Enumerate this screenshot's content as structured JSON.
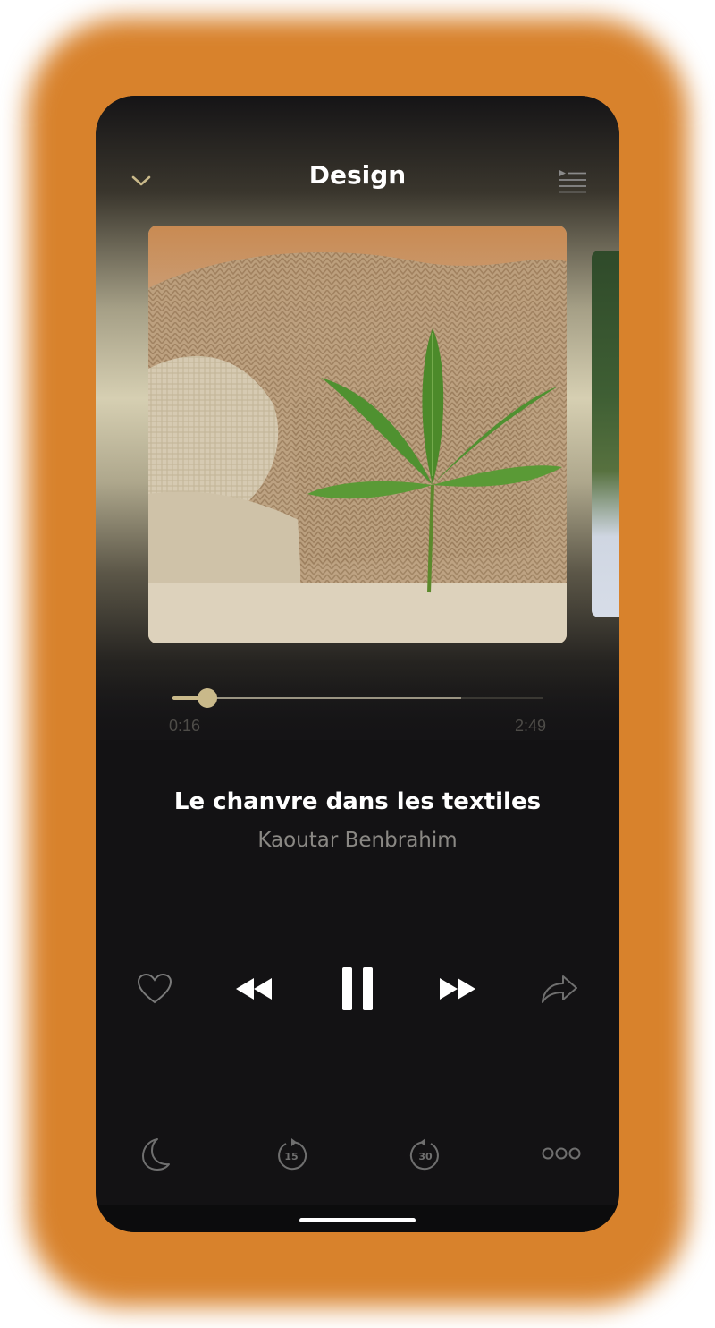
{
  "header": {
    "title": "Design",
    "collapse_icon": "chevron-down-icon",
    "queue_icon": "playlist-icon"
  },
  "artwork": {
    "current": "hemp-leaf-on-knitted-textile",
    "next": "trees-peek"
  },
  "playback": {
    "elapsed": "0:16",
    "duration": "2:49",
    "progress_fraction": 0.095,
    "buffered_fraction": 0.78
  },
  "track": {
    "title": "Le chanvre dans les textiles",
    "artist": "Kaoutar Benbrahim"
  },
  "controls": {
    "like": "heart-icon",
    "previous": "rewind-icon",
    "play_pause": "pause-icon",
    "next": "fast-forward-icon",
    "share": "share-icon"
  },
  "secondary_controls": {
    "sleep": "moon-icon",
    "skip_back": "15",
    "skip_forward": "30",
    "more": "more-icon"
  },
  "colors": {
    "accent": "#c9b98a",
    "background": "#131214",
    "frame_glow": "#d8822c"
  }
}
